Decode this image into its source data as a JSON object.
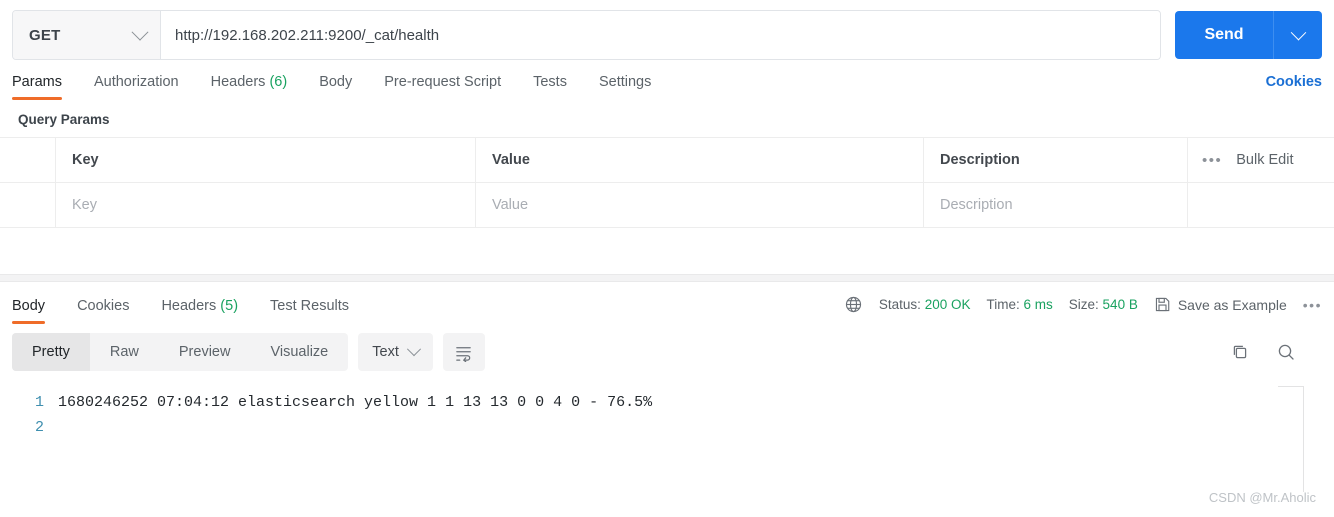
{
  "request": {
    "method": "GET",
    "url": "http://192.168.202.211:9200/_cat/health",
    "send_label": "Send",
    "tabs": [
      {
        "label": "Params",
        "count": ""
      },
      {
        "label": "Authorization",
        "count": ""
      },
      {
        "label": "Headers",
        "count": "(6)"
      },
      {
        "label": "Body",
        "count": ""
      },
      {
        "label": "Pre-request Script",
        "count": ""
      },
      {
        "label": "Tests",
        "count": ""
      },
      {
        "label": "Settings",
        "count": ""
      }
    ],
    "cookies_link": "Cookies"
  },
  "query_params": {
    "section_title": "Query Params",
    "headers": {
      "key": "Key",
      "value": "Value",
      "description": "Description"
    },
    "bulk_edit_label": "Bulk Edit",
    "rows": [
      {
        "key_placeholder": "Key",
        "value_placeholder": "Value",
        "description_placeholder": "Description"
      }
    ]
  },
  "response": {
    "tabs": [
      {
        "label": "Body",
        "count": ""
      },
      {
        "label": "Cookies",
        "count": ""
      },
      {
        "label": "Headers",
        "count": "(5)"
      },
      {
        "label": "Test Results",
        "count": ""
      }
    ],
    "status_label": "Status:",
    "status_value": "200 OK",
    "time_label": "Time:",
    "time_value": "6 ms",
    "size_label": "Size:",
    "size_value": "540 B",
    "save_example_label": "Save as Example",
    "more_dots": "•••",
    "format_tabs": [
      {
        "label": "Pretty"
      },
      {
        "label": "Raw"
      },
      {
        "label": "Preview"
      },
      {
        "label": "Visualize"
      }
    ],
    "content_type": "Text",
    "body_lines": [
      {
        "num": "1",
        "text": "1680246252 07:04:12 elasticsearch yellow 1 1 13 13 0 0 4 0 - 76.5%"
      },
      {
        "num": "2",
        "text": ""
      }
    ]
  },
  "watermark": "CSDN @Mr.Aholic",
  "colors": {
    "accent_orange": "#ef6c29",
    "send_blue": "#1b78ec",
    "link_blue": "#1a6fd4",
    "status_green": "#1aa260"
  }
}
